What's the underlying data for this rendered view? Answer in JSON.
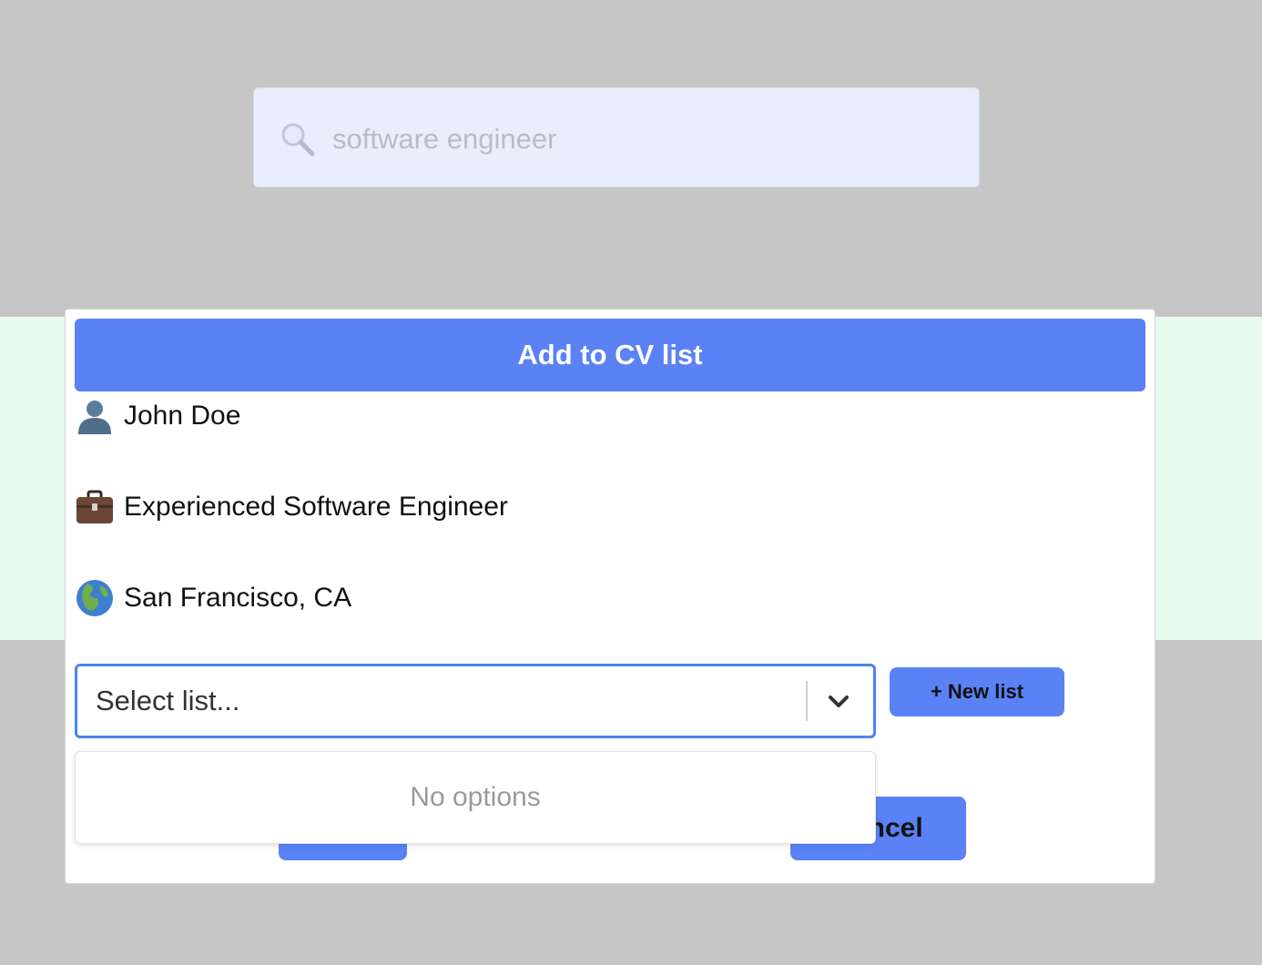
{
  "search": {
    "value": "software engineer",
    "icon": "magnifier-icon"
  },
  "modal": {
    "title": "Add to CV list",
    "candidate": {
      "name": "John Doe",
      "name_icon": "person-silhouette-icon",
      "title": "Experienced Software Engineer",
      "title_icon": "briefcase-icon",
      "location": "San Francisco, CA",
      "location_icon": "globe-icon"
    },
    "select": {
      "placeholder": "Select list...",
      "menu_empty_text": "No options",
      "chevron_icon": "chevron-down-icon"
    },
    "new_list_label": "+ New list",
    "cancel_label": "Cancel",
    "submit_label": ""
  },
  "colors": {
    "accent": "#5a82f5",
    "overlay_background": "#c6c6c6",
    "search_background": "#e9eefc",
    "band_background": "#e8fbec",
    "focus_border": "#4b84ef"
  }
}
